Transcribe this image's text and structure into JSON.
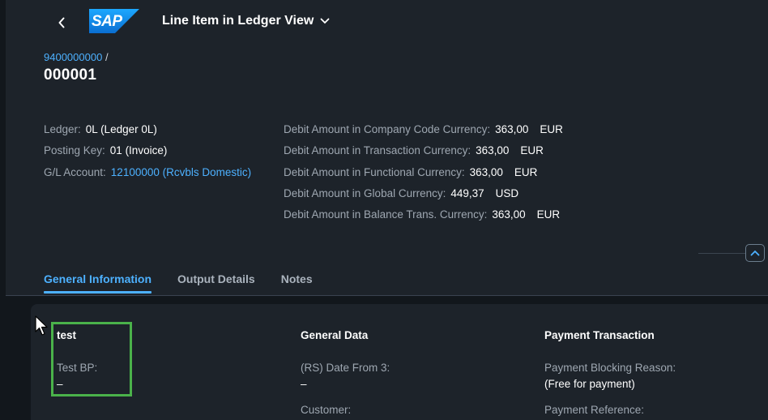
{
  "header": {
    "app_title": "Line Item in Ledger View",
    "logo_text": "SAP",
    "breadcrumb": {
      "link": "9400000000",
      "separator": "/"
    },
    "object_title": "000001"
  },
  "attributes_left": [
    {
      "label": "Ledger:",
      "value": "0L (Ledger 0L)",
      "is_link": false
    },
    {
      "label": "Posting Key:",
      "value": "01 (Invoice)",
      "is_link": false
    },
    {
      "label": "G/L Account:",
      "value": "12100000 (Rcvbls Domestic)",
      "is_link": true
    }
  ],
  "attributes_right": [
    {
      "label": "Debit Amount in Company Code Currency:",
      "value": "363,00",
      "currency": "EUR"
    },
    {
      "label": "Debit Amount in Transaction Currency:",
      "value": "363,00",
      "currency": "EUR"
    },
    {
      "label": "Debit Amount in Functional Currency:",
      "value": "363,00",
      "currency": "EUR"
    },
    {
      "label": "Debit Amount in Global Currency:",
      "value": "449,37",
      "currency": "USD"
    },
    {
      "label": "Debit Amount in Balance Trans. Currency:",
      "value": "363,00",
      "currency": "EUR"
    }
  ],
  "tabs": [
    {
      "label": "General Information",
      "active": true
    },
    {
      "label": "Output Details",
      "active": false
    },
    {
      "label": "Notes",
      "active": false
    }
  ],
  "sections": {
    "test": {
      "title": "test",
      "fields": [
        {
          "label": "Test BP:",
          "value": "–"
        }
      ]
    },
    "general_data": {
      "title": "General Data",
      "fields": [
        {
          "label": "(RS) Date From 3:",
          "value": "–"
        },
        {
          "label": "Customer:",
          "value": ""
        }
      ]
    },
    "payment_transaction": {
      "title": "Payment Transaction",
      "fields": [
        {
          "label": "Payment Blocking Reason:",
          "value": "(Free for payment)"
        },
        {
          "label": "Payment Reference:",
          "value": ""
        }
      ]
    }
  },
  "colors": {
    "background": "#1d232a",
    "content_background": "#12171c",
    "accent": "#4db1ff",
    "highlight": "#4ab24a"
  }
}
